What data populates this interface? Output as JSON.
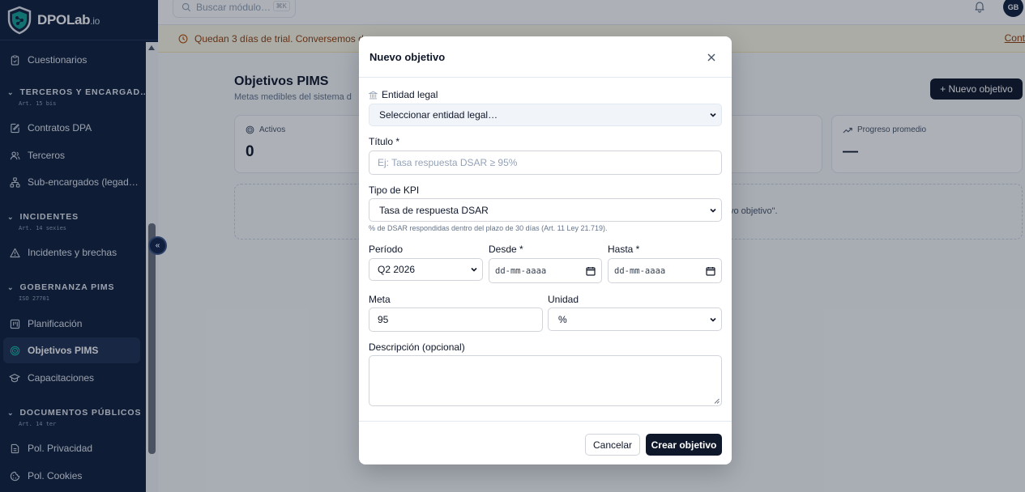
{
  "brand": {
    "name": "DPOLab",
    "suffix": ".io"
  },
  "sidebar": {
    "items": [
      {
        "label": "Cuestionarios",
        "icon": "clipboard-icon"
      },
      {
        "label": "Contratos DPA",
        "icon": "document-edit-icon"
      },
      {
        "label": "Terceros",
        "icon": "users-icon"
      },
      {
        "label": "Sub-encargados (legad…",
        "icon": "network-icon"
      },
      {
        "label": "Incidentes y brechas",
        "icon": "alert-triangle-icon"
      },
      {
        "label": "Planificación",
        "icon": "kanban-icon"
      },
      {
        "label": "Objetivos PIMS",
        "icon": "target-icon",
        "active": true
      },
      {
        "label": "Capacitaciones",
        "icon": "graduation-cap-icon"
      },
      {
        "label": "Pol. Privacidad",
        "icon": "document-icon"
      },
      {
        "label": "Pol. Cookies",
        "icon": "cookie-icon"
      }
    ],
    "sections": [
      {
        "title": "TERCEROS Y ENCARGAD…",
        "sub": "Art. 15 bis"
      },
      {
        "title": "INCIDENTES",
        "sub": "Art. 14 sexies"
      },
      {
        "title": "GOBERNANZA PIMS",
        "sub": "ISO 27701"
      },
      {
        "title": "DOCUMENTOS PÚBLICOS",
        "sub": "Art. 14 ter"
      }
    ]
  },
  "topbar": {
    "search_placeholder": "Buscar módulo…",
    "search_shortcut": "⌘K",
    "avatar_initials": "GB"
  },
  "trial": {
    "text": "Quedan 3 días de trial. Conversemos de",
    "cta": "Cont"
  },
  "page": {
    "title": "Objetivos PIMS",
    "subtitle": "Metas medibles del sistema d",
    "new_button": "+ Nuevo objetivo",
    "cards": [
      {
        "label": "Activos",
        "value": "0"
      },
      {
        "label": "Progreso promedio",
        "value": "—"
      }
    ],
    "empty_text": "vo objetivo\"."
  },
  "modal": {
    "title": "Nuevo objetivo",
    "entidad_label": "Entidad legal",
    "entidad_value": "Seleccionar entidad legal…",
    "titulo_label": "Título *",
    "titulo_placeholder": "Ej: Tasa respuesta DSAR ≥ 95%",
    "kpi_label": "Tipo de KPI",
    "kpi_value": "Tasa de respuesta DSAR",
    "kpi_hint": "% de DSAR respondidas dentro del plazo de 30 días (Art. 11 Ley 21.719).",
    "periodo_label": "Período",
    "periodo_value": "Q2 2026",
    "desde_label": "Desde *",
    "desde_value": "dd-mm-aaaa",
    "hasta_label": "Hasta *",
    "hasta_value": "dd-mm-aaaa",
    "meta_label": "Meta",
    "meta_value": "95",
    "unidad_label": "Unidad",
    "unidad_value": "%",
    "descripcion_label": "Descripción (opcional)",
    "cancel": "Cancelar",
    "create": "Crear objetivo"
  }
}
